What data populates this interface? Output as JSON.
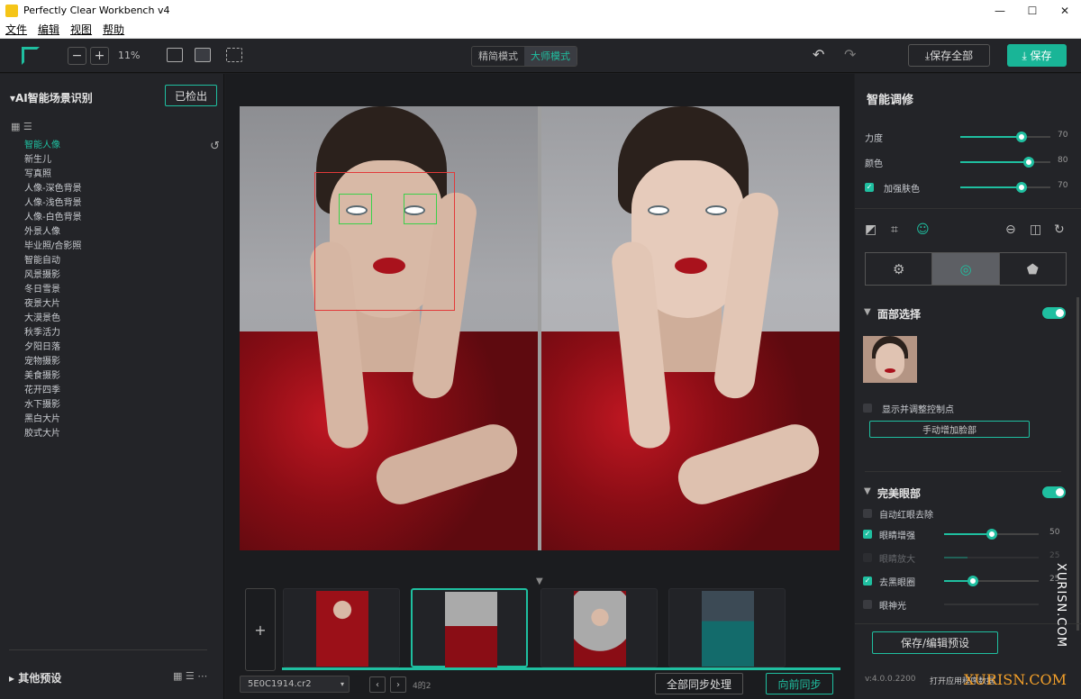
{
  "window": {
    "title": "Perfectly Clear Workbench v4",
    "min": "—",
    "max": "☐",
    "close": "✕"
  },
  "menu": [
    "文件",
    "编辑",
    "视图",
    "帮助"
  ],
  "toolbar": {
    "zoom_minus": "−",
    "zoom_plus": "+",
    "zoom_level": "11%",
    "modes": [
      "精简模式",
      "大师模式"
    ],
    "active_mode": "大师模式",
    "undo": "↶",
    "redo": "↷",
    "save_all": "⤓保存全部",
    "save": "⤓ 保存"
  },
  "left_panel": {
    "title": "▾AI智能场景识别",
    "detected_button": "已检出",
    "view_icons": "▦  ☰",
    "reset_icon": "↺",
    "scenes": [
      "智能人像",
      "新生儿",
      "写真照",
      "人像-深色背景",
      "人像-浅色背景",
      "人像-白色背景",
      "外景人像",
      "毕业照/合影照",
      "智能自动",
      "风景摄影",
      "冬日雪景",
      "夜景大片",
      "大漠景色",
      "秋季活力",
      "夕阳日落",
      "宠物摄影",
      "美食摄影",
      "花开四季",
      "水下摄影",
      "黑白大片",
      "胶式大片"
    ],
    "active_scene": "智能人像",
    "other_presets": "▸  其他预设",
    "other_icons": "▦ ☰ ⋯"
  },
  "center": {
    "nav_arrow": "▼",
    "add_label": "+",
    "file_name": "5E0C1914.cr2",
    "file_caret": "▾",
    "prev": "‹",
    "next": "›",
    "page_count": "4的2",
    "sync_all": "全部同步处理",
    "sync_forward": "向前同步"
  },
  "right_panel": {
    "title": "智能调修",
    "sliders_top": [
      {
        "label": "力度",
        "value": "70",
        "pct": 0.68
      },
      {
        "label": "颜色",
        "value": "80",
        "pct": 0.76
      },
      {
        "label": "加强肤色",
        "value": "70",
        "pct": 0.68,
        "checkbox": true
      }
    ],
    "tool_icons": [
      "◩",
      "⌗",
      "☺",
      "⊖",
      "◫",
      "↻"
    ],
    "tabs": [
      "⚙",
      "◎",
      "⬟"
    ],
    "face_select": {
      "title": "面部选择",
      "show_points": "显示并调整控制点",
      "manual_add": "手动增加脸部"
    },
    "perfect_eyes": {
      "title": "完美眼部",
      "items": [
        {
          "label": "自动红眼去除",
          "checked": false
        },
        {
          "label": "眼睛增强",
          "checked": true,
          "value": "50",
          "pct": 0.5
        },
        {
          "label": "眼睛放大",
          "checked": false,
          "value": "25",
          "pct": 0.25
        },
        {
          "label": "去黑眼圈",
          "checked": true,
          "value": "25",
          "pct": 0.3
        },
        {
          "label": "眼神光",
          "checked": false
        }
      ]
    },
    "save_preset": "保存/编辑预设",
    "version": "v:4.0.0.2200",
    "open_folder": "打开应用程序数据"
  },
  "watermark": {
    "vertical": "XURISN.COM",
    "bottom": "XURISN.COM"
  }
}
